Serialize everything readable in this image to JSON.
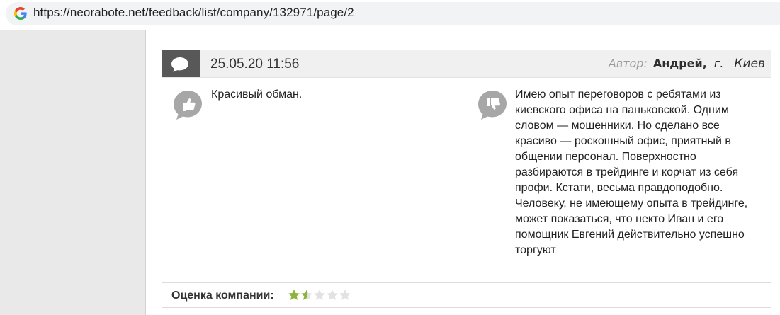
{
  "browser": {
    "url": "https://neorabote.net/feedback/list/company/132971/page/2",
    "site_icon": "google-g-icon"
  },
  "review": {
    "date": "25.05.20 11:56",
    "author_label": "Автор:",
    "author_name": "Андрей",
    "city_prefix": "г.",
    "city": "Киев",
    "pros": {
      "icon": "thumbs-up-icon",
      "text": "Красивый обман."
    },
    "cons": {
      "icon": "thumbs-down-icon",
      "text": "Имею опыт переговоров с ребятами из киевского офиса на паньковской. Одним словом — мошенники. Но сделано все красиво — роскошный офис, приятный в общении персонал. Поверхностно разбираются в трейдинге и корчат из себя профи. Кстати, весьма правдоподобно. Человеку, не имеющему опыта в трейдинге, может показаться, что некто Иван и его помощник Евгений действительно успешно торгуют"
    },
    "rating_label": "Оценка компании:",
    "rating": 1.5,
    "rating_max": 5,
    "colors": {
      "star_filled": "#8db33a",
      "star_empty": "#e2e2e2",
      "header_badge": "#585858",
      "icon_grey": "#a7a7a7"
    }
  }
}
